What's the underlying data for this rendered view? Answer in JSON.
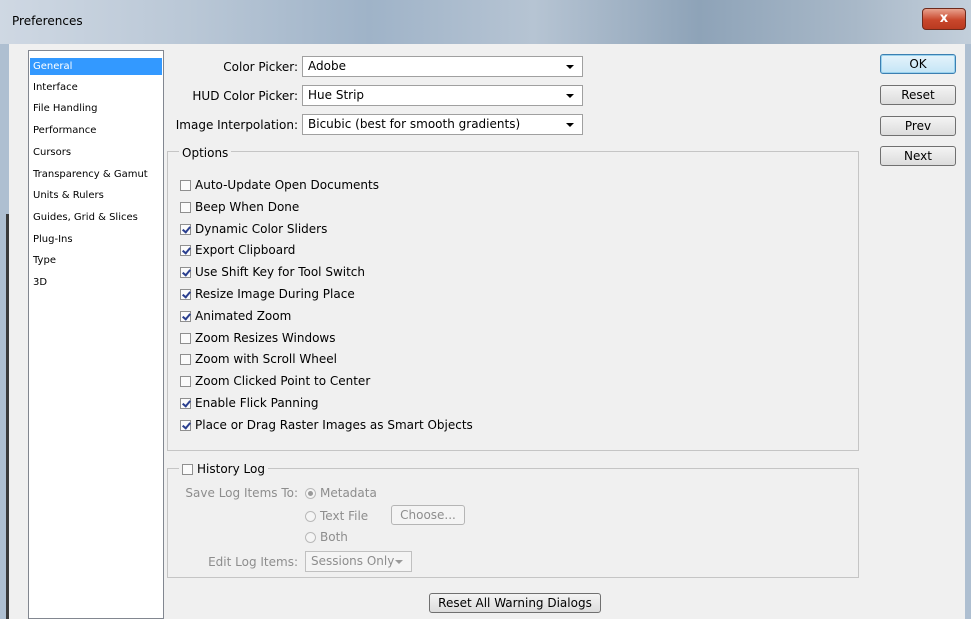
{
  "window": {
    "title": "Preferences",
    "close_label": "x"
  },
  "categories": [
    "General",
    "Interface",
    "File Handling",
    "Performance",
    "Cursors",
    "Transparency & Gamut",
    "Units & Rulers",
    "Guides, Grid & Slices",
    "Plug-Ins",
    "Type",
    "3D"
  ],
  "selected_category": "General",
  "color_picker": {
    "label": "Color Picker:",
    "value": "Adobe"
  },
  "hud_color_picker": {
    "label": "HUD Color Picker:",
    "value": "Hue Strip"
  },
  "image_interpolation": {
    "label": "Image Interpolation:",
    "value": "Bicubic (best for smooth gradients)"
  },
  "options": {
    "legend": "Options",
    "items": [
      {
        "label": "Auto-Update Open Documents",
        "checked": false
      },
      {
        "label": "Beep When Done",
        "checked": false
      },
      {
        "label": "Dynamic Color Sliders",
        "checked": true
      },
      {
        "label": "Export Clipboard",
        "checked": true
      },
      {
        "label": "Use Shift Key for Tool Switch",
        "checked": true
      },
      {
        "label": "Resize Image During Place",
        "checked": true
      },
      {
        "label": "Animated Zoom",
        "checked": true
      },
      {
        "label": "Zoom Resizes Windows",
        "checked": false
      },
      {
        "label": "Zoom with Scroll Wheel",
        "checked": false
      },
      {
        "label": "Zoom Clicked Point to Center",
        "checked": false
      },
      {
        "label": "Enable Flick Panning",
        "checked": true
      },
      {
        "label": "Place or Drag Raster Images as Smart Objects",
        "checked": true
      }
    ]
  },
  "history_log": {
    "label": "History Log",
    "checked": false,
    "save_to_label": "Save Log Items To:",
    "radio_metadata": "Metadata",
    "radio_text_file": "Text File",
    "choose_button": "Choose...",
    "radio_both": "Both",
    "edit_label": "Edit Log Items:",
    "edit_value": "Sessions Only"
  },
  "reset_warnings_button": "Reset All Warning Dialogs",
  "buttons": {
    "ok": "OK",
    "reset": "Reset",
    "prev": "Prev",
    "next": "Next"
  }
}
